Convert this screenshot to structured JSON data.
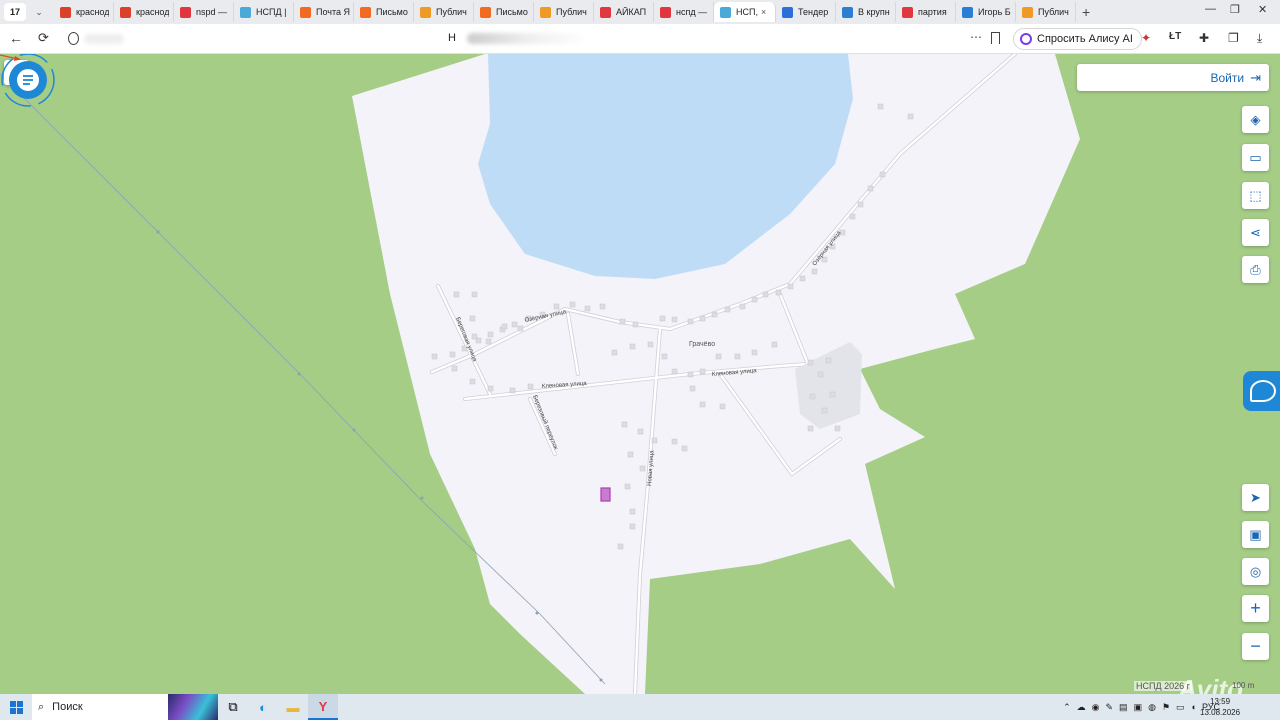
{
  "browser": {
    "tab_count": "17",
    "tabs": [
      {
        "label": "краснод",
        "color": "#d9412b"
      },
      {
        "label": "краснод",
        "color": "#d9412b"
      },
      {
        "label": "nspd —",
        "color": "#e0383e"
      },
      {
        "label": "НСПД |",
        "color": "#49a9d9"
      },
      {
        "label": "Почта Я",
        "color": "#f26a21"
      },
      {
        "label": "Письмо",
        "color": "#f26a21"
      },
      {
        "label": "Публич",
        "color": "#f09a26"
      },
      {
        "label": "Письмо",
        "color": "#f26a21"
      },
      {
        "label": "Публич",
        "color": "#f09a26"
      },
      {
        "label": "АЙКАП",
        "color": "#e0383e"
      },
      {
        "label": "нспд —",
        "color": "#e0383e"
      },
      {
        "label": "НСП,",
        "color": "#49a9d9",
        "active": true
      },
      {
        "label": "Тендер",
        "color": "#2d6fd8"
      },
      {
        "label": "В крупн",
        "color": "#2a7fd4"
      },
      {
        "label": "партия",
        "color": "#e0383e"
      },
      {
        "label": "Игорь Б",
        "color": "#2a7fd4"
      },
      {
        "label": "Публич",
        "color": "#f09a26"
      }
    ],
    "tab_close": "×",
    "new_tab": "+",
    "minimize": "—",
    "restore": "❐",
    "close": "✕",
    "back_icon": "←",
    "reload_icon": "⟳",
    "url_visible": "Н",
    "alice_label": "Спросить Алису AI"
  },
  "map": {
    "login_label": "Войти",
    "place_name": "Грачёво",
    "streets": {
      "ozernaya_west": "Озёрная улица",
      "ozernaya_east": "Озёрная улица",
      "beregovaya": "Береговая улица",
      "klenovaya_west": "Кленовая улица",
      "klenovaya_east": "Кленовая улица",
      "berezovy": "Березовый переулок",
      "novaya": "Новая улица"
    },
    "footer_source": "НСПД 2026 г",
    "footer_scale": "100 m",
    "watermark": "Avito",
    "colors": {
      "forest": "#a5cd86",
      "settlement": "#f3f3f9",
      "water": "#bfdcf7",
      "roads": "#ffffff",
      "buildings": "#dcdce2",
      "parcel": "#c97bd2",
      "accent": "#1a66b0"
    },
    "tools": [
      "layers-icon",
      "ruler-icon",
      "select-area-icon",
      "share-icon",
      "print-icon",
      "locate-icon",
      "minimap-icon",
      "geotag-icon",
      "zoom-in-icon",
      "zoom-out-icon"
    ]
  },
  "taskbar": {
    "search_label": "Поиск",
    "lang": "РУС",
    "time": "13:59",
    "date": "13.08.2026"
  }
}
